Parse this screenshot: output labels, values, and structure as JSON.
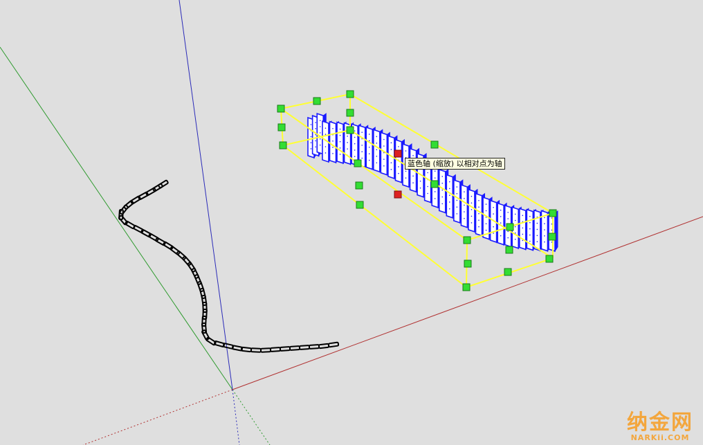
{
  "viewport": {
    "background": "#dfdfdf",
    "axes": {
      "red_axis_color": "#b03030",
      "green_axis_color": "#2e9a2e",
      "blue_axis_color": "#2a2ab8"
    },
    "selection_color": "#ffff33",
    "grip_color": "#33dd33",
    "pivot_color": "#dd2222",
    "model_color": "#1a1aff"
  },
  "tooltip": {
    "text": "蓝色轴 (缩放) 以相对点为轴"
  },
  "watermark": {
    "chinese": "纳金网",
    "english": "NARKii.COM"
  }
}
